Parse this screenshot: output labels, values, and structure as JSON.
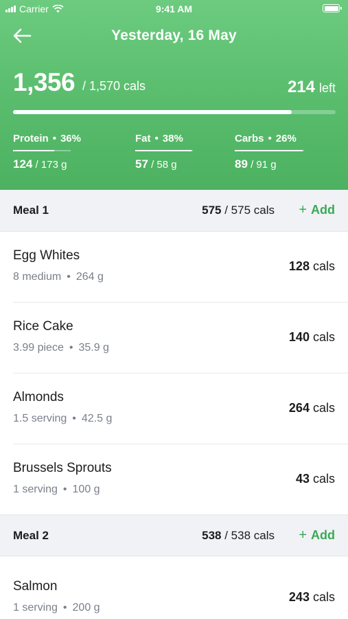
{
  "status_bar": {
    "carrier": "Carrier",
    "time": "9:41 AM"
  },
  "header": {
    "title": "Yesterday, 16 May",
    "calories_eaten": "1,356",
    "calories_goal": "/ 1,570 cals",
    "calories_left_value": "214",
    "calories_left_label": "left",
    "progress_fraction": 0.864,
    "macros": [
      {
        "name": "Protein",
        "pct": "36%",
        "value": "124",
        "goal": "/ 173 g",
        "fraction": 0.72
      },
      {
        "name": "Fat",
        "pct": "38%",
        "value": "57",
        "goal": "/ 58 g",
        "fraction": 0.98
      },
      {
        "name": "Carbs",
        "pct": "26%",
        "value": "89",
        "goal": "/ 91 g",
        "fraction": 0.98
      }
    ]
  },
  "meals": [
    {
      "name": "Meal 1",
      "cals_value": "575",
      "cals_total": "/ 575 cals",
      "add_label": "Add",
      "items": [
        {
          "name": "Egg Whites",
          "amount": "8 medium",
          "weight": "264 g",
          "cals": "128",
          "unit": "cals"
        },
        {
          "name": "Rice Cake",
          "amount": "3.99 piece",
          "weight": "35.9 g",
          "cals": "140",
          "unit": "cals"
        },
        {
          "name": "Almonds",
          "amount": "1.5 serving",
          "weight": "42.5 g",
          "cals": "264",
          "unit": "cals"
        },
        {
          "name": "Brussels Sprouts",
          "amount": "1 serving",
          "weight": "100 g",
          "cals": "43",
          "unit": "cals"
        }
      ]
    },
    {
      "name": "Meal 2",
      "cals_value": "538",
      "cals_total": "/ 538 cals",
      "add_label": "Add",
      "items": [
        {
          "name": "Salmon",
          "amount": "1 serving",
          "weight": "200 g",
          "cals": "243",
          "unit": "cals"
        }
      ]
    }
  ],
  "colors": {
    "header_green": "#58bc6c",
    "accent_green": "#3aa956"
  }
}
